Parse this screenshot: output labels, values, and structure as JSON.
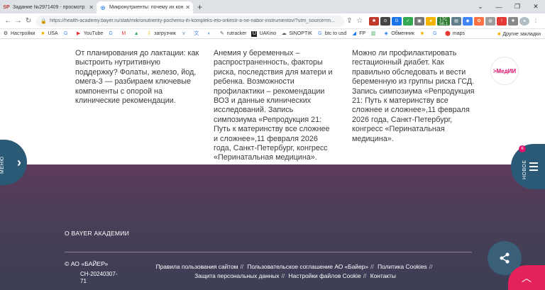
{
  "browser": {
    "tabs": [
      {
        "favicon": "SP",
        "title": "Задание №2971409 - просмотр з"
      },
      {
        "favicon": "◎",
        "title": "Микронутриенты: почему их кон"
      }
    ],
    "url": "https://health-academy.bayer.ru/stati/mikronutrienty-pochemu-ih-kompleks-eto-orkestr-a-ne-nabor-instrumentov/?utm_source=m...",
    "bookmarks": [
      "Настройки",
      "USA",
      "YouTube",
      "загрузчик",
      "rutracker",
      "UAKino",
      "SINOPTIK",
      "btc to usd",
      "FP",
      "Обменник",
      "maps"
    ],
    "other_bookmarks": "Другие закладки",
    "ext_badges": {
      "ltc": "LTC",
      "ltc_val": "58.1"
    }
  },
  "articles": [
    {
      "text": "От планирования до лактации: как выстроить нутритивную поддержку? Фолаты, железо, йод, омега-3 — разбираем ключевые компоненты с опорой на клинические рекомендации."
    },
    {
      "text": "Анемия у беременных – распространенность, факторы риска, последствия для матери и ребенка. Возможности профилактики – рекомендации ВОЗ и данные клинических исследований. Запись симпозиума «Репродукция 21: Путь к материнству все сложнее и сложнее»,11 февраля 2026 года, Санкт-Петербург, конгресс «Перинатальная медицина»."
    },
    {
      "text": "Можно ли профилактировать гестационный диабет. Как правильно обследовать и вести беременную из группы риска ГСД. Запись симпозиума «Репродукция 21: Путь к материнству все сложнее и сложнее»,11 февраля 2026 года, Санкт-Петербург, конгресс «Перинатальная медицина»."
    }
  ],
  "medii_logo": ">МедИИ",
  "side_menu_label": "МЕНЮ",
  "side_new_label": "НОВОЕ",
  "side_new_badge": "6",
  "footer": {
    "about": "О BAYER АКАДЕМИИ",
    "copyright": "© АО «БАЙЕР»",
    "code": "CH-20240307-71",
    "links": [
      "Правила пользования сайтом",
      "Пользовательское соглашение АО «Байер»",
      "Политика Cookies",
      "Защита персональных данных",
      "Настройки файлов Cookie",
      "Контакты"
    ]
  },
  "colors": {
    "accent": "#e5215b",
    "footer": "#4b3d57",
    "side": "#2b5a76"
  }
}
